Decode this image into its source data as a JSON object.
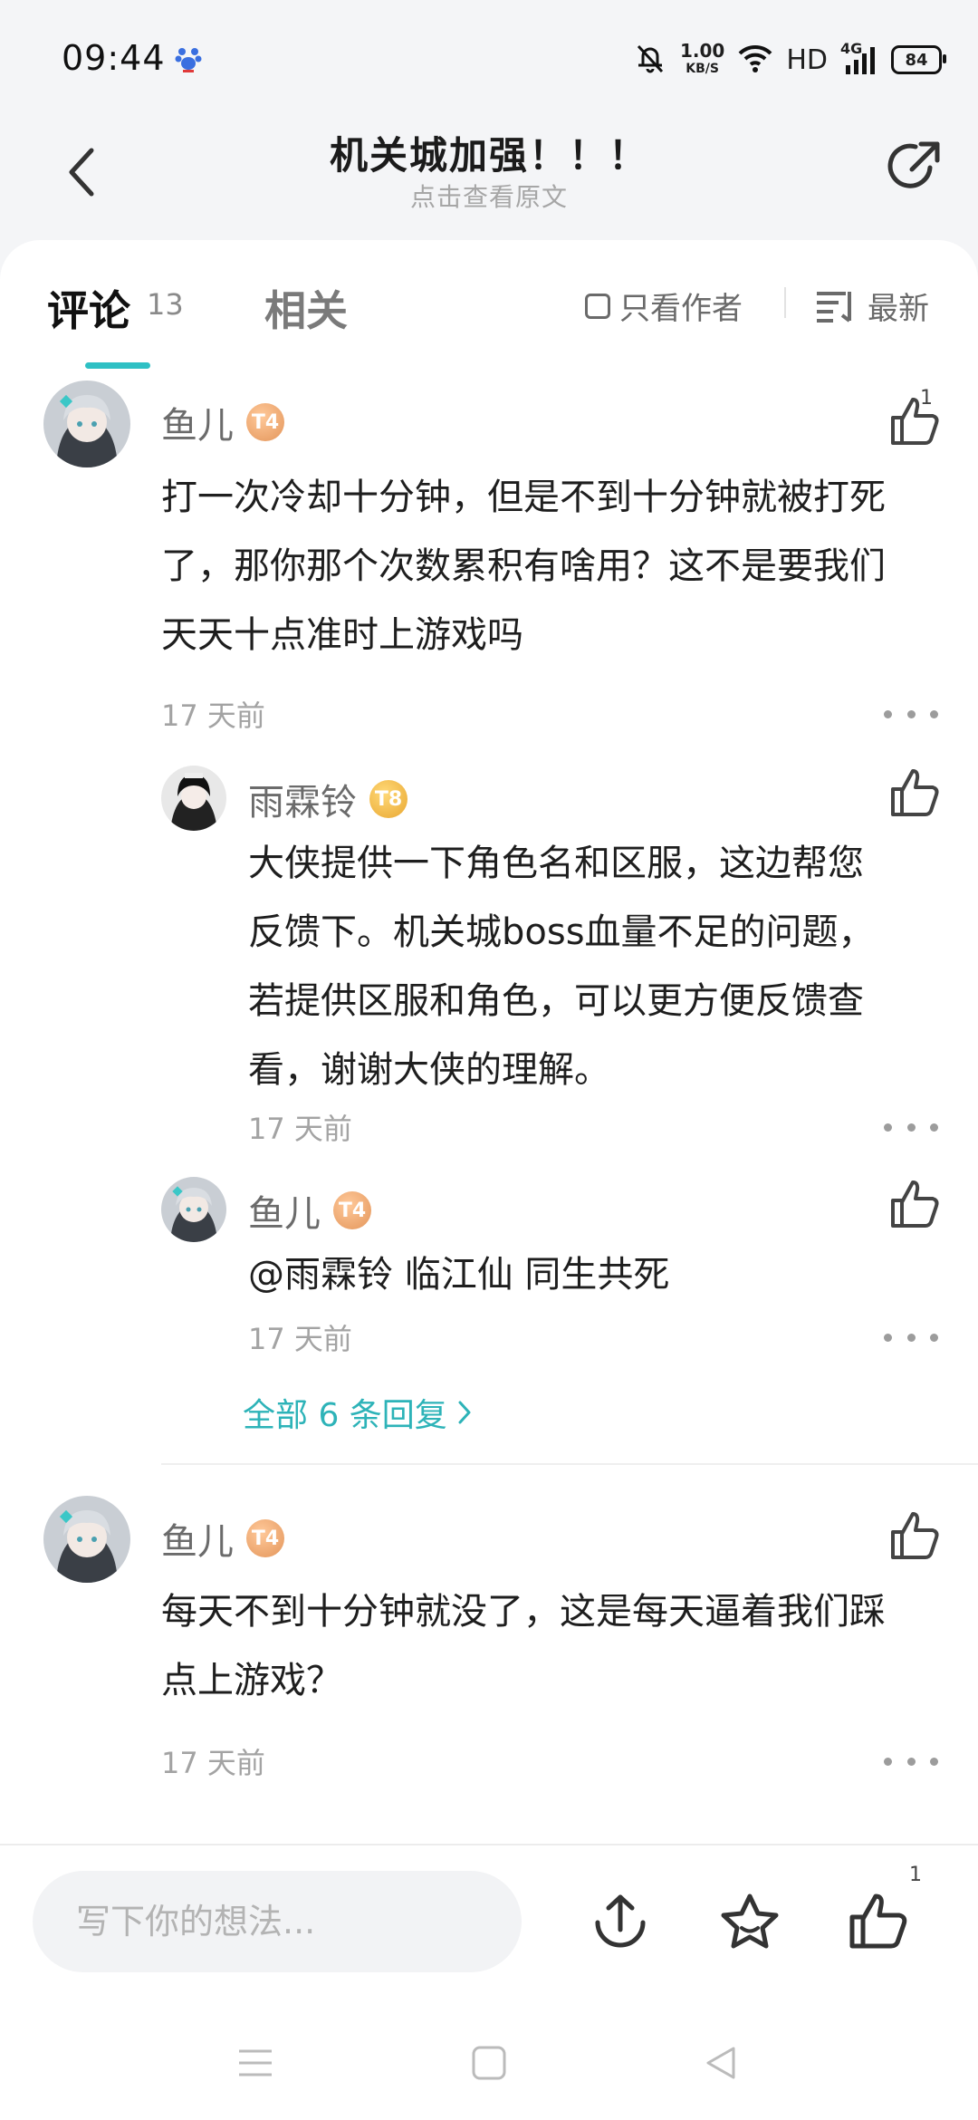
{
  "status_bar": {
    "time": "09:44",
    "speed_value": "1.00",
    "speed_unit": "KB/S",
    "hd_label": "HD",
    "network_label": "4G",
    "battery": "84"
  },
  "header": {
    "title": "机关城加强！！！",
    "subtitle": "点击查看原文"
  },
  "tabs": {
    "comments_label": "评论",
    "comments_count": "13",
    "related_label": "相关",
    "author_only_label": "只看作者",
    "sort_label": "最新"
  },
  "comments": [
    {
      "author": "鱼儿",
      "level": "T4",
      "text_lines": [
        "打一次冷却十分钟，但是不到十分钟就被打死",
        "了，那你那个次数累积有啥用？这不是要我们",
        "天天十点准时上游戏吗"
      ],
      "time": "17 天前",
      "likes": "1",
      "replies": [
        {
          "author": "雨霖铃",
          "level": "T8",
          "text_lines": [
            "大侠提供一下角色名和区服，这边帮您",
            "反馈下。机关城boss血量不足的问题，",
            "若提供区服和角色，可以更方便反馈查",
            "看，谢谢大侠的理解。"
          ],
          "time": "17 天前"
        },
        {
          "author": "鱼儿",
          "level": "T4",
          "text_lines": [
            "@雨霖铃  临江仙  同生共死"
          ],
          "time": "17 天前"
        }
      ],
      "view_all_replies": "全部 6 条回复"
    },
    {
      "author": "鱼儿",
      "level": "T4",
      "text_lines": [
        "每天不到十分钟就没了，这是每天逼着我们踩",
        "点上游戏？"
      ],
      "time": "17 天前"
    }
  ],
  "bottom_bar": {
    "input_placeholder": "写下你的想法...",
    "like_count": "1"
  },
  "colors": {
    "accent": "#2ec0c4",
    "link": "#2db3b8",
    "background": "#f4f5f7"
  }
}
